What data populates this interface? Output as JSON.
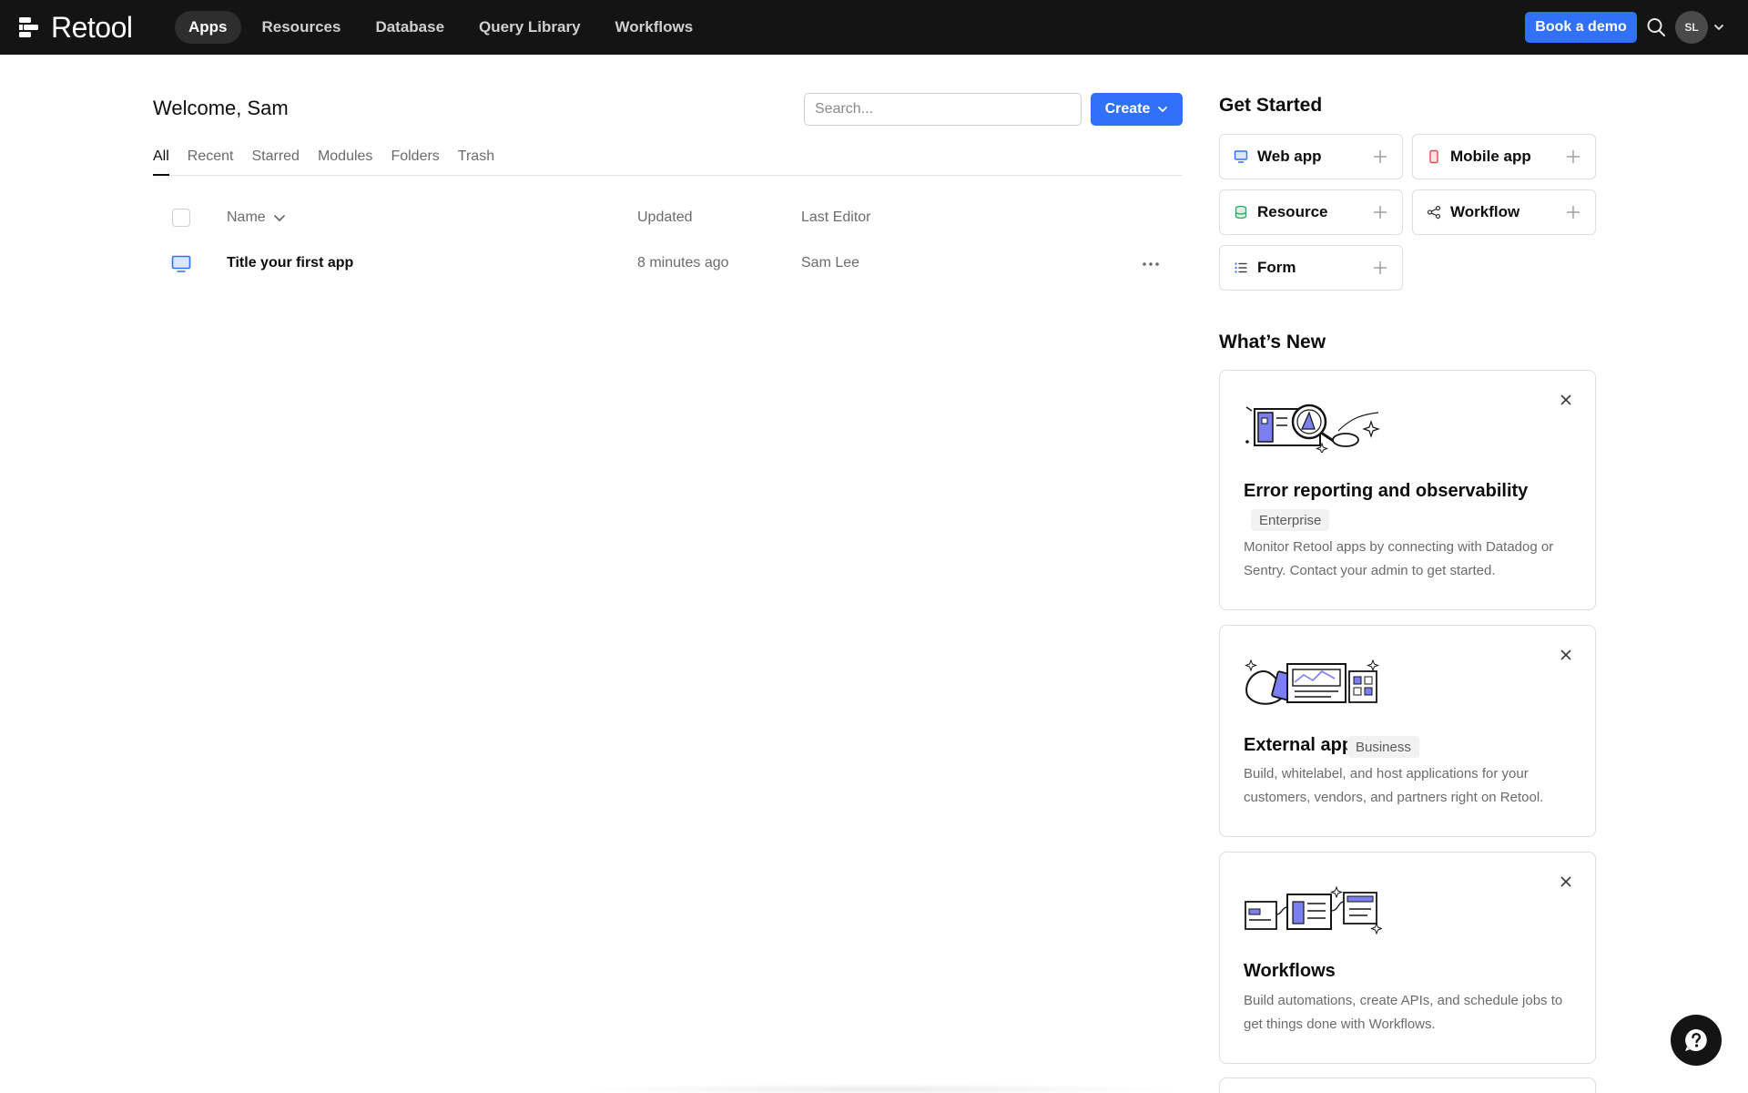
{
  "topbar": {
    "brand": "Retool",
    "nav": [
      {
        "label": "Apps",
        "active": true
      },
      {
        "label": "Resources",
        "active": false
      },
      {
        "label": "Database",
        "active": false
      },
      {
        "label": "Query Library",
        "active": false
      },
      {
        "label": "Workflows",
        "active": false
      }
    ],
    "book_demo_label": "Book a demo",
    "search_icon": "search-icon",
    "avatar_initials": "SL"
  },
  "main": {
    "welcome": "Welcome, Sam",
    "search_placeholder": "Search...",
    "create_label": "Create",
    "tabs": [
      {
        "label": "All",
        "active": true
      },
      {
        "label": "Recent",
        "active": false
      },
      {
        "label": "Starred",
        "active": false
      },
      {
        "label": "Modules",
        "active": false
      },
      {
        "label": "Folders",
        "active": false
      },
      {
        "label": "Trash",
        "active": false
      }
    ],
    "columns": {
      "name": "Name",
      "updated": "Updated",
      "last_editor": "Last Editor"
    },
    "rows": [
      {
        "name": "Title your first app",
        "updated": "8 minutes ago",
        "last_editor": "Sam Lee",
        "icon": "monitor-icon"
      }
    ]
  },
  "get_started": {
    "title": "Get Started",
    "items": [
      {
        "label": "Web app",
        "icon": "monitor-icon",
        "color": "#3170f9"
      },
      {
        "label": "Mobile app",
        "icon": "mobile-icon",
        "color": "#e5484d"
      },
      {
        "label": "Resource",
        "icon": "database-icon",
        "color": "#30a46c"
      },
      {
        "label": "Workflow",
        "icon": "workflow-icon",
        "color": "#3a3a3a"
      },
      {
        "label": "Form",
        "icon": "list-icon",
        "color": "#3170f9"
      }
    ]
  },
  "whats_new": {
    "title": "What’s New",
    "cards": [
      {
        "title": "Error reporting and observability",
        "badge": "Enterprise",
        "description": "Monitor Retool apps by connecting with Datadog or Sentry. Contact your admin to get started."
      },
      {
        "title": "External apps",
        "badge": "Business",
        "description": "Build, whitelabel, and host applications for your customers, vendors, and partners right on Retool."
      },
      {
        "title": "Workflows",
        "badge": "",
        "description": "Build automations, create APIs, and schedule jobs to get things done with Workflows."
      }
    ]
  },
  "colors": {
    "accent": "#3170f9",
    "topbar": "#141414",
    "illustration_purple": "#7b7ff0"
  }
}
